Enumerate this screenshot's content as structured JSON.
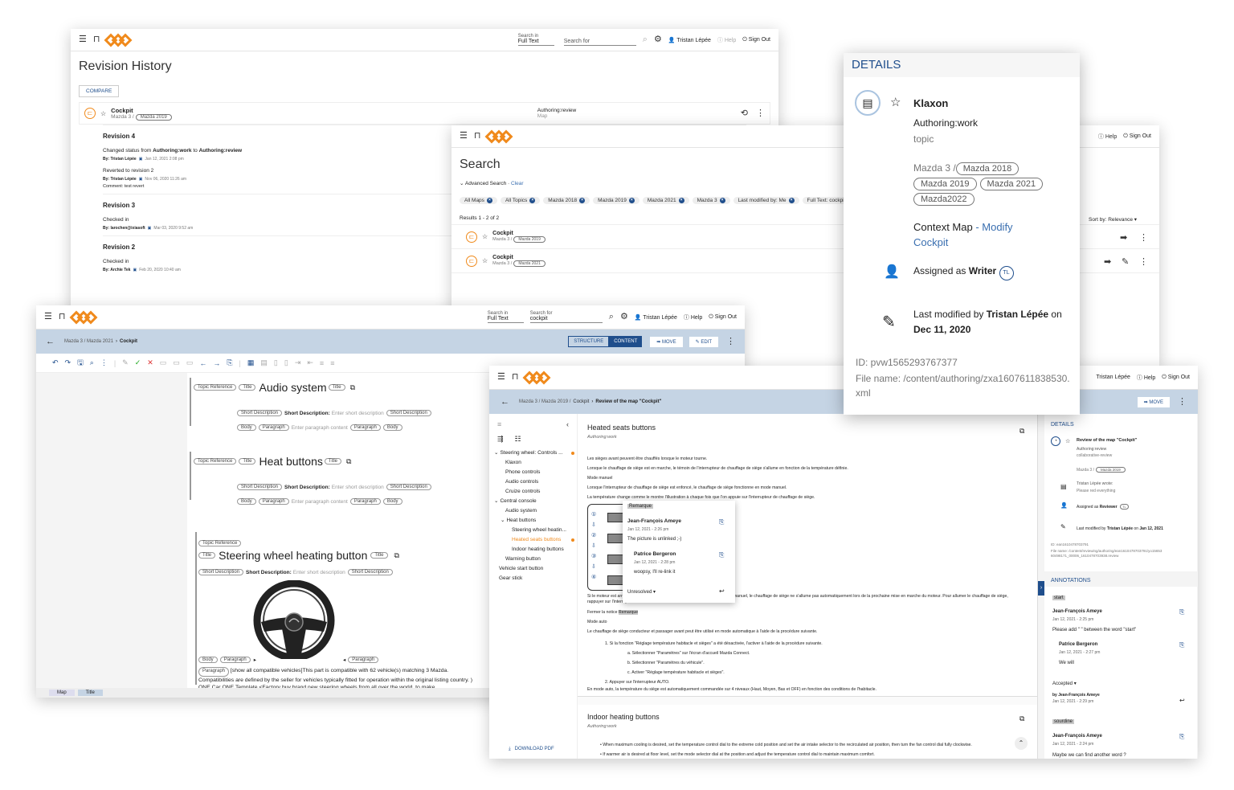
{
  "topbar": {
    "search_in_label": "Search in",
    "search_in_value": "Full Text",
    "search_for_label": "Search for",
    "search_placeholder": "Search for",
    "search_value": "cockpit",
    "user": "Tristan Lépée",
    "help": "Help",
    "signout": "Sign Out"
  },
  "revision": {
    "title": "Revision History",
    "compare": "COMPARE",
    "item_title": "Cockpit",
    "item_path": "Mazda 3 /",
    "item_chip": "Mazda 2019",
    "item_status": "Authoring:review",
    "item_type": "Map",
    "revisions": [
      {
        "name": "Revision 4",
        "entries": [
          {
            "text_a": "Changed status from ",
            "from": "Authoring:work",
            "text_b": " to ",
            "to": "Authoring:review",
            "by": "By: Tristan Lépée",
            "date": "Jan 12, 2021 2:08 pm"
          },
          {
            "text_a": "Reverted to revision 2",
            "by": "By: Tristan Lépée",
            "date": "Nov 06, 2020 11:26 am",
            "comment": "Comment: test revert"
          }
        ]
      },
      {
        "name": "Revision 3",
        "entries": [
          {
            "text_a": "Checked in",
            "by": "By: larochen@ixiasoft",
            "date": "Mar 03, 2020 9:52 am"
          }
        ]
      },
      {
        "name": "Revision 2",
        "entries": [
          {
            "text_a": "Checked in",
            "by": "By: Archie Tek",
            "date": "Feb 20, 2020 10:40 am"
          }
        ]
      }
    ]
  },
  "search": {
    "title": "Search",
    "adv": "Advanced Search",
    "clear": "Clear",
    "chips": [
      "All Maps",
      "All Topics",
      "Mazda 2018",
      "Mazda 2019",
      "Mazda 2021",
      "Mazda 3",
      "Last modified by: Me",
      "Full Text: cockpit"
    ],
    "results_label": "Results 1 - 2 of 2",
    "sort_label": "Sort by:",
    "sort_value": "Relevance",
    "results": [
      {
        "title": "Cockpit",
        "path": "Mazda 3 /",
        "chip": "Mazda 2019"
      },
      {
        "title": "Cockpit",
        "path": "Mazda 3 /",
        "chip": "Mazda 2021"
      }
    ]
  },
  "details": {
    "heading": "DETAILS",
    "title": "Klaxon",
    "status": "Authoring:work",
    "type": "topic",
    "path": "Mazda 3 /",
    "chips": [
      "Mazda 2018",
      "Mazda 2019",
      "Mazda 2021",
      "Mazda2022"
    ],
    "context_label": "Context Map",
    "context_link": "- Modify",
    "context_map": "Cockpit",
    "assigned_a": "Assigned as ",
    "assigned_role": "Writer",
    "assigned_badge": "TL",
    "modified_a": "Last modified by ",
    "modified_user": "Tristan Lépée",
    "modified_b": " on ",
    "modified_date": "Dec 11, 2020",
    "id": "ID: pvw1565293767377",
    "file": "File name: /content/authoring/zxa1607611838530.xml"
  },
  "editor": {
    "breadcrumb_path": "Mazda 3 / Mazda 2021",
    "breadcrumb_current": "Cockpit",
    "structure": "STRUCTURE",
    "content": "CONTENT",
    "move": "MOVE",
    "edit": "EDIT",
    "sections": [
      {
        "heading": "Audio system",
        "sd_label": "Short Description:",
        "sd_ph": "Enter short description",
        "p_ph": "Enter paragraph content"
      },
      {
        "heading": "Heat buttons",
        "sd_label": "Short Description:",
        "sd_ph": "Enter short description",
        "p_ph": "Enter paragraph content"
      }
    ],
    "topic_ref": "Topic Reference",
    "title_tag": "Title",
    "sd_tag": "Short Description",
    "body_tag": "Body",
    "para_tag": "Paragraph",
    "sw_heading": "Steering wheel heating button",
    "sw_sd_label": "Short Description:",
    "sw_sd_ph": "Enter short description",
    "compat_text": "[show all compatible vehicles]This part is compatible with 62 vehicle(s) matching 3 Mazda. Compatibilities are defined by the seller for vehicles typically fitted for operation within the original listing country. ) ONE Car ONE Template <Factory buy brand new steering wheels from all over the world, to make",
    "tabs": [
      "Map",
      "Title"
    ]
  },
  "review": {
    "breadcrumb_path": "Mazda 3 / Mazda 2019 /",
    "breadcrumb_map": "Cockpit",
    "breadcrumb_current": "Review of the map \"Cockpit\"",
    "move": "MOVE",
    "tree": [
      {
        "label": "Steering wheel: Controls ...",
        "lvl": 0,
        "caret": true,
        "dot": true
      },
      {
        "label": "Klaxon",
        "lvl": 1
      },
      {
        "label": "Phone controls",
        "lvl": 1
      },
      {
        "label": "Audio controls",
        "lvl": 1
      },
      {
        "label": "Cruize controls",
        "lvl": 1
      },
      {
        "label": "Central console",
        "lvl": 0,
        "caret": true
      },
      {
        "label": "Audio system",
        "lvl": 1
      },
      {
        "label": "Heat buttons",
        "lvl": 1,
        "caret": true
      },
      {
        "label": "Steering wheel heatin...",
        "lvl": 2
      },
      {
        "label": "Heated seats buttons",
        "lvl": 2,
        "active": true,
        "dot": true
      },
      {
        "label": "Indoor heating buttons",
        "lvl": 2
      },
      {
        "label": "Warning button",
        "lvl": 1
      },
      {
        "label": "Vehicle start button",
        "lvl": 0
      },
      {
        "label": "Gear stick",
        "lvl": 0
      }
    ],
    "download": "DOWNLOAD PDF",
    "topic_title": "Heated seats buttons",
    "topic_status": "Authoring:work",
    "paras": [
      "Les sièges avant peuvent être chauffés lorsque le moteur tourne.",
      "Lorsque le chauffage de siège est en marche, le témoin de l'interrupteur de chauffage de siège s'allume en fonction de la température définie.",
      "Mode manuel",
      "Lorsque l'interrupteur de chauffage de siège est enfoncé, le chauffage de siège fonctionne en mode manuel.",
      "La température change comme le montre l'illustration à chaque fois que l'on appuie sur l'interrupteur de chauffage de siège."
    ],
    "para_after": "Si le moteur est arrêté alors que le chauffage de siège est en marche en mode manuel, le chauffage de siège ne s'allume pas automatiquement lors de la prochaine mise en marche du moteur. Pour allumer le chauffage de siège, rappuyer sur l'interrupteur.",
    "fermer_a": "Fermer la notice ",
    "fermer_hl": "Remarque",
    "mode_auto": "Mode auto",
    "auto_text": "Le chauffage de siège conducteur et passager avant peut être utilisé en mode automatique à l'aide de la procédure suivante.",
    "steps": [
      "1. Si la fonction \"Réglage température habitacle et sièges\" a été désactivée, l'activer à l'aide de la procédure suivante.",
      "a. Sélectionner \"Paramètres\" sur l'écran d'accueil Mazda Connect.",
      "b. Sélectionner \"Paramètres du véhicule\".",
      "c. Activer \"Réglage température habitacle et sièges\".",
      "2. Appuyer sur l'interrupteur AUTO."
    ],
    "auto_end": "En mode auto, la température du siège est automatiquement commandée sur 4 niveaux (Haut, Moyen, Bas et OFF) en fonction des conditions de l'habitacle.",
    "topic2_title": "Indoor heating buttons",
    "topic2_status": "Authoring:work",
    "bullets": [
      "When maximum cooling is desired, set the temperature control dial to the extreme cold position and set the air intake selector to the recirculated air position, then turn the fan control dial fully clockwise.",
      "If warmer air is desired at floor level, set the mode selector dial at the position and adjust the temperature control dial to maintain maximum comfort."
    ],
    "popup": {
      "tag": "Remarque",
      "c1_name": "Jean-François Ameye",
      "c1_date": "Jan 12, 2021 - 2:26 pm",
      "c1_text": "The picture is unlinked ;-)",
      "c2_name": "Patrice Bergeron",
      "c2_date": "Jan 12, 2021 - 2:28 pm",
      "c2_text": "woopsy, I'll re-link it",
      "status": "Unresolved"
    },
    "details": {
      "heading": "DETAILS",
      "title": "Review of the map \"Cockpit\"",
      "status": "Authoring:review",
      "type": "collaborative-review",
      "path": "Mazda 3 /",
      "chip": "Mazda 2019",
      "wrote_label": "Tristan Lépée wrote:",
      "wrote_text": "Please red everything",
      "assigned": "Assigned as ",
      "role": "Reviewer",
      "badge": "TL",
      "modified_a": "Last modified by ",
      "modified_user": "Tristan Lépée",
      "modified_b": " on ",
      "modified_date": "Jan 12, 2021",
      "id": "ID: ean1610478703791",
      "file": "File name: /content/reviewing/authoring/ean1610478703791/yo15653 60498171_00006_1610478703938.review"
    },
    "annotations": {
      "heading": "ANNOTATIONS",
      "a1_tag": "start",
      "a1_name": "Jean-François Ameye",
      "a1_date": "Jan 12, 2021 - 2:25 pm",
      "a1_text": "Please add \" \" between the word \"start\"",
      "a1_r_name": "Patrice Bergeron",
      "a1_r_date": "Jan 12, 2021 - 2:27 pm",
      "a1_r_text": "We will",
      "a1_status": "Accepted",
      "a1_by": "by Jean-François Ameye",
      "a1_by_date": "Jan 12, 2021 - 2:29 pm",
      "a2_tag": "sourdine",
      "a2_name": "Jean-François Ameye",
      "a2_date": "Jan 12, 2021 - 2:24 pm",
      "a2_text": "Maybe we can find another word ?"
    }
  },
  "colors": {
    "accent": "#f08a1c",
    "brand_blue": "#1f4e8c",
    "breadcrumb_bg": "#c5d4e4",
    "link": "#3a6fb0"
  }
}
